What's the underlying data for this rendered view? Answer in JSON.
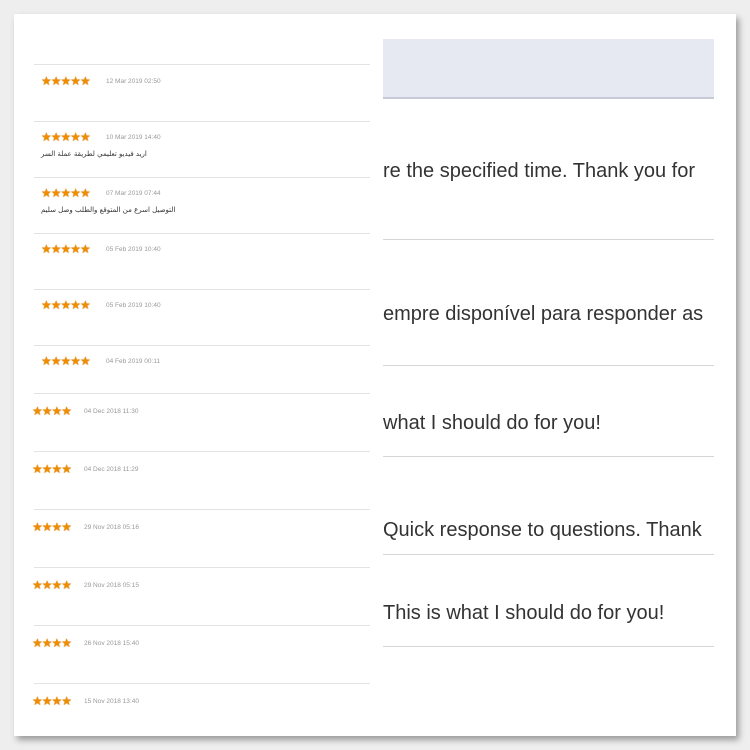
{
  "left_reviews": [
    {
      "stars": "★★★★★",
      "date": "12 Mar 2019 02:50",
      "comment": ""
    },
    {
      "stars": "★★★★★",
      "date": "10 Mar 2019 14:40",
      "comment": "اريد فيديو تعليمي لطريقة عملة السر"
    },
    {
      "stars": "★★★★★",
      "date": "07 Mar 2019 07:44",
      "comment": "التوصيل اسرع من المتوقع والطلب وصل سليم"
    },
    {
      "stars": "★★★★★",
      "date": "05 Feb 2019 10:40",
      "comment": ""
    },
    {
      "stars": "★★★★★",
      "date": "05 Feb 2019 10:40",
      "comment": ""
    },
    {
      "stars": "★★★★★",
      "date": "04 Feb 2019 00:11",
      "comment": ""
    },
    {
      "stars": "★★★★",
      "date": "04 Dec 2018 11:30",
      "comment": ""
    },
    {
      "stars": "★★★★",
      "date": "04 Dec 2018 11:29",
      "comment": ""
    },
    {
      "stars": "★★★★",
      "date": "29 Nov 2018 05:16",
      "comment": ""
    },
    {
      "stars": "★★★★",
      "date": "29 Nov 2018 05:15",
      "comment": ""
    },
    {
      "stars": "★★★★",
      "date": "26 Nov 2018 15:40",
      "comment": ""
    },
    {
      "stars": "★★★★",
      "date": "15 Nov 2018 13:40",
      "comment": ""
    }
  ],
  "right_messages": [
    "re the specified time. Thank you for",
    "empre disponível para responder as",
    "what I should do for you!",
    " Quick response to questions. Thank",
    "This is what I should do for you!"
  ],
  "colors": {
    "star": "#f08c00",
    "header_band": "#e6e8f2",
    "date_text": "#999999",
    "message_text": "#333333"
  },
  "icons": {
    "rating": "star-icon"
  }
}
